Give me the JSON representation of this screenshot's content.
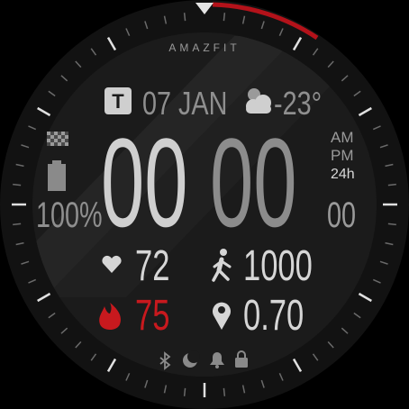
{
  "watch": {
    "brand": "AMAZFIT",
    "colors": {
      "bezel": "#141414",
      "face": "#1c1c1c",
      "text": "#d6d6d6",
      "dim_text": "#8a8a8a",
      "accent_red": "#c8191e",
      "arc_red": "#b3121a"
    },
    "date": {
      "weekday_badge": "T",
      "label": "07 JAN"
    },
    "weather": {
      "icon": "partly-cloudy-icon",
      "temperature": "-23°"
    },
    "time": {
      "hours": "00",
      "minutes": "00",
      "seconds": "00",
      "ampm_am": "AM",
      "ampm_pm": "PM",
      "format_24h": "24h"
    },
    "battery": {
      "icon": "battery-icon",
      "percent": "100%"
    },
    "stats": {
      "heart_rate": "72",
      "steps": "1000",
      "calories": "75",
      "distance": "0.70"
    },
    "status_icons": [
      "bluetooth-icon",
      "moon-icon",
      "bell-icon",
      "lock-icon"
    ]
  }
}
